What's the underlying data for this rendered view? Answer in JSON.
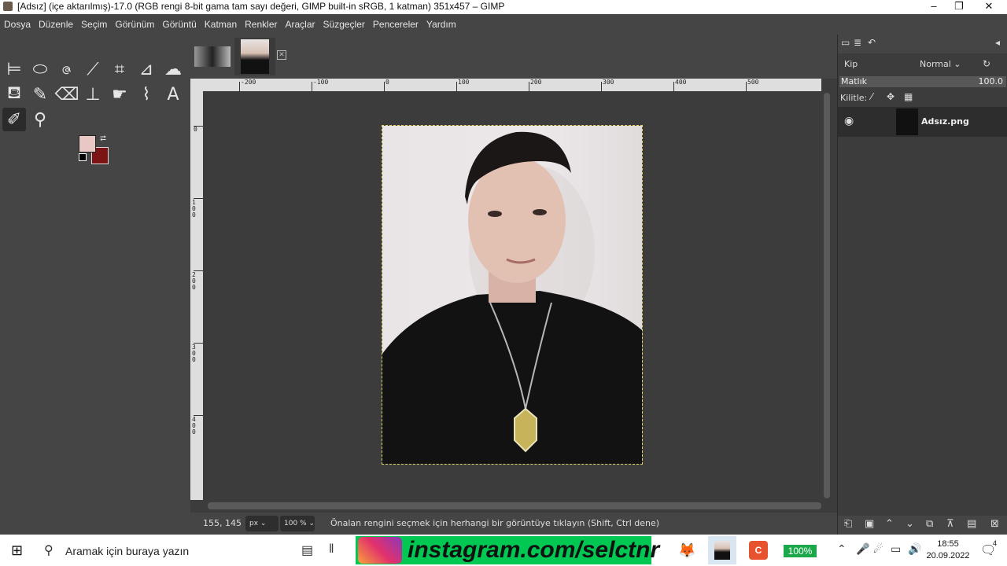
{
  "window": {
    "title": "[Adsız] (içe aktarılmış)-17.0 (RGB rengi 8-bit gama tam sayı değeri, GIMP built-in sRGB, 1 katman) 351x457 – GIMP",
    "minimize": "–",
    "maximize": "❐",
    "close": "✕"
  },
  "menu": [
    "Dosya",
    "Düzenle",
    "Seçim",
    "Görünüm",
    "Görüntü",
    "Katman",
    "Renkler",
    "Araçlar",
    "Süzgeçler",
    "Pencereler",
    "Yardım"
  ],
  "colors": {
    "foreground": "#e8c7c4",
    "background": "#7c1416",
    "accent": "#00c853"
  },
  "rulers": {
    "horizontal": [
      "-200",
      "-100",
      "0",
      "100",
      "200",
      "300",
      "400",
      "500"
    ],
    "vertical": [
      "0",
      "100",
      "200",
      "300",
      "400"
    ]
  },
  "status": {
    "coords": "155, 145",
    "unit": "px",
    "zoom": "100 %",
    "message": "Önalan rengini seçmek için herhangi bir görüntüye tıklayın (Shift, Ctrl dene)"
  },
  "layers": {
    "mode_label": "Kip",
    "mode_value": "Normal",
    "opacity_label": "Matlık",
    "opacity_value": "100.0",
    "lock_label": "Kilitle:",
    "items": [
      {
        "name": "Adsız.png"
      }
    ]
  },
  "taskbar": {
    "search_placeholder": "Aramak için buraya yazın",
    "promo_text": "instagram.com/selctnr",
    "battery": "100%",
    "time": "18:55",
    "date": "20.09.2022",
    "notification_count": "4"
  }
}
